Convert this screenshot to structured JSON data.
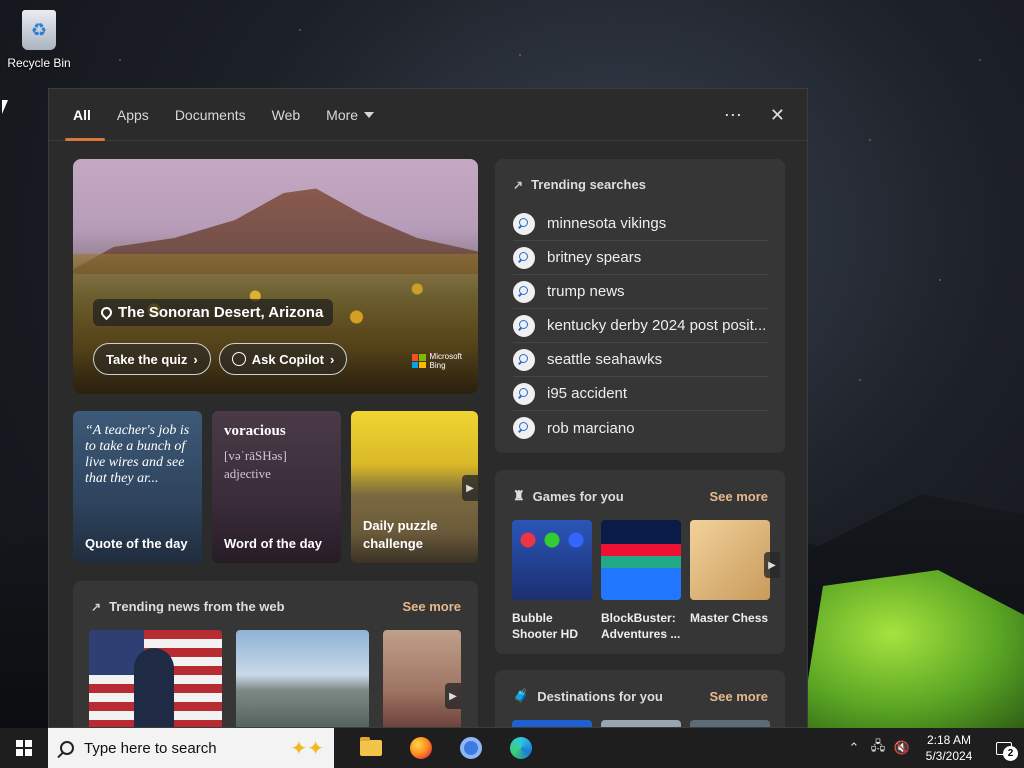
{
  "desktop": {
    "recycle_bin_label": "Recycle Bin"
  },
  "search_panel": {
    "tabs": [
      {
        "label": "All",
        "active": true
      },
      {
        "label": "Apps"
      },
      {
        "label": "Documents"
      },
      {
        "label": "Web"
      },
      {
        "label": "More"
      }
    ],
    "more_options_icon": "ellipsis-icon",
    "close_icon": "close-icon",
    "hero": {
      "location": "The Sonoran Desert, Arizona",
      "quiz_button": "Take the quiz",
      "copilot_button": "Ask Copilot",
      "brand_line1": "Microsoft",
      "brand_line2": "Bing"
    },
    "small_cards": {
      "quote_text": "“A teacher's job is to take a bunch of live wires and see that they ar...",
      "quote_label": "Quote of the day",
      "word": "voracious",
      "word_phonetic": "[vəˈrāSHəs]",
      "word_pos": "adjective",
      "word_label": "Word of the day",
      "puzzle_label": "Daily puzzle challenge"
    },
    "trending_news": {
      "title": "Trending news from the web",
      "see_more": "See more"
    },
    "trending_searches": {
      "title": "Trending searches",
      "items": [
        "minnesota vikings",
        "britney spears",
        "trump news",
        "kentucky derby 2024 post posit...",
        "seattle seahawks",
        "i95 accident",
        "rob marciano"
      ]
    },
    "games": {
      "title": "Games for you",
      "see_more": "See more",
      "items": [
        "Bubble Shooter HD",
        "BlockBuster: Adventures ...",
        "Master Chess"
      ]
    },
    "destinations": {
      "title": "Destinations for you",
      "see_more": "See more"
    }
  },
  "taskbar": {
    "search_placeholder": "Type here to search",
    "time": "2:18 AM",
    "date": "5/3/2024",
    "notification_count": "2"
  },
  "colors": {
    "accent": "#d7763d",
    "see_more": "#e8b88c",
    "panel_bg": "#2b2b2b",
    "card_bg": "#363636"
  }
}
